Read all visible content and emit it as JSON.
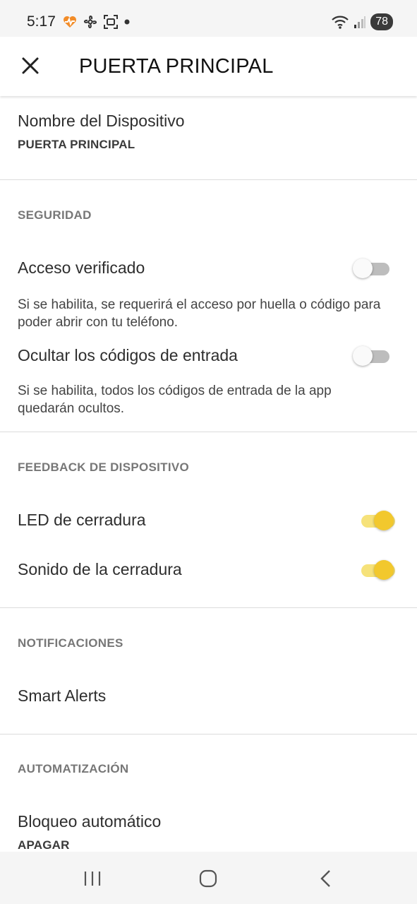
{
  "status_bar": {
    "time": "5:17",
    "battery": "78",
    "icons_left": [
      "heart-pulse-icon",
      "fan-icon",
      "screen-capture-icon",
      "dot-icon"
    ],
    "icons_right": [
      "wifi-icon",
      "signal-icon",
      "battery-icon"
    ]
  },
  "header": {
    "title": "PUERTA PRINCIPAL",
    "close_icon": "close-icon"
  },
  "device_name": {
    "label": "Nombre del Dispositivo",
    "value": "PUERTA PRINCIPAL"
  },
  "security": {
    "header": "SEGURIDAD",
    "verified_access": {
      "label": "Acceso verificado",
      "enabled": false,
      "desc_line1": "Si se habilita, se requerirá el acceso por huella o código para",
      "desc_line2": "poder abrir con tu teléfono."
    },
    "hide_codes": {
      "label": "Ocultar los códigos de entrada",
      "enabled": false,
      "desc_line1": "Si se habilita, todos los códigos de entrada de la app",
      "desc_line2": "quedarán ocultos."
    }
  },
  "feedback": {
    "header": "FEEDBACK DE DISPOSITIVO",
    "led": {
      "label": "LED de cerradura",
      "enabled": true
    },
    "sound": {
      "label": "Sonido de la cerradura",
      "enabled": true
    }
  },
  "notifications": {
    "header": "NOTIFICACIONES",
    "smart_alerts": "Smart Alerts"
  },
  "automation": {
    "header": "AUTOMATIZACIÓN",
    "auto_lock": {
      "label": "Bloqueo automático",
      "value": "APAGAR"
    }
  },
  "colors": {
    "accent": "#f2c82d",
    "accent_track": "#f6e27a",
    "off_track": "#bdbdbd"
  }
}
